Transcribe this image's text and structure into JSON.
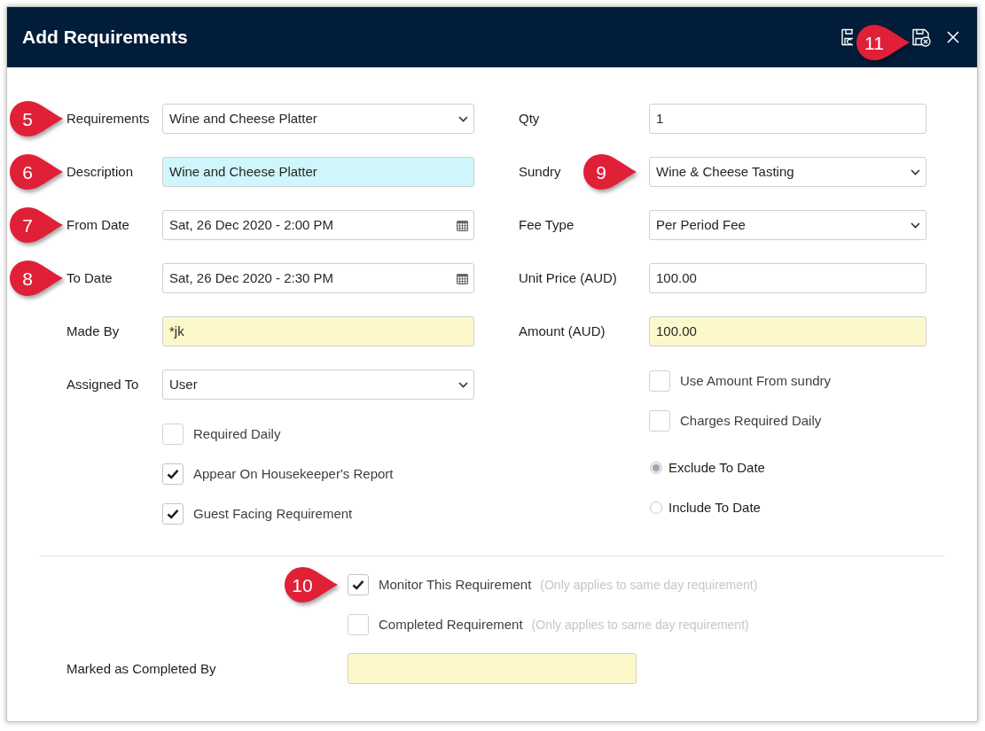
{
  "dialog": {
    "title": "Add Requirements",
    "callout": "11"
  },
  "left_fields": [
    {
      "label": "Requirements",
      "kind": "select",
      "value": "Wine and Cheese Platter",
      "color": "#ffffff",
      "callout": "5"
    },
    {
      "label": "Description",
      "kind": "text",
      "value": "Wine and Cheese Platter",
      "color": "#cff6fa",
      "callout": "6"
    },
    {
      "label": "From Date",
      "kind": "date",
      "value": "Sat, 26 Dec 2020 - 2:00 PM",
      "color": "#ffffff",
      "callout": "7"
    },
    {
      "label": "To Date",
      "kind": "date",
      "value": "Sat, 26 Dec 2020 - 2:30 PM",
      "color": "#ffffff",
      "callout": "8"
    },
    {
      "label": "Made By",
      "kind": "text",
      "value": "*jk",
      "color": "#fdf8cc"
    },
    {
      "label": "Assigned To",
      "kind": "select",
      "value": "User",
      "color": "#ffffff"
    }
  ],
  "left_options": [
    {
      "label": "Required Daily",
      "checked": false
    },
    {
      "label": "Appear On Housekeeper's Report",
      "checked": true
    },
    {
      "label": "Guest Facing Requirement",
      "checked": true
    }
  ],
  "right_fields": [
    {
      "label": "Qty",
      "kind": "text",
      "value": "1",
      "color": "#ffffff"
    },
    {
      "label": "Sundry",
      "kind": "select",
      "value": "Wine & Cheese Tasting",
      "color": "#ffffff",
      "callout": "9"
    },
    {
      "label": "Fee Type",
      "kind": "select",
      "value": "Per Period Fee",
      "color": "#ffffff"
    },
    {
      "label": "Unit Price (AUD)",
      "kind": "text",
      "value": "100.00",
      "color": "#ffffff"
    },
    {
      "label": "Amount (AUD)",
      "kind": "text",
      "value": "100.00",
      "color": "#fdf8cc"
    }
  ],
  "right_options": [
    {
      "label": "Use Amount From sundry",
      "checked": false
    },
    {
      "label": "Charges Required Daily",
      "checked": false
    }
  ],
  "to_date_mode": [
    {
      "label": "Exclude To Date",
      "selected": true
    },
    {
      "label": "Include To Date",
      "selected": false
    }
  ],
  "monitoring": [
    {
      "label": "Monitor This Requirement",
      "note": "(Only applies to same day requirement)",
      "checked": true,
      "callout": "10"
    },
    {
      "label": "Completed Requirement",
      "note": "(Only applies to same day requirement)",
      "checked": false
    }
  ],
  "completed_by": {
    "label": "Marked as Completed By",
    "color": "#fdf8cc"
  }
}
